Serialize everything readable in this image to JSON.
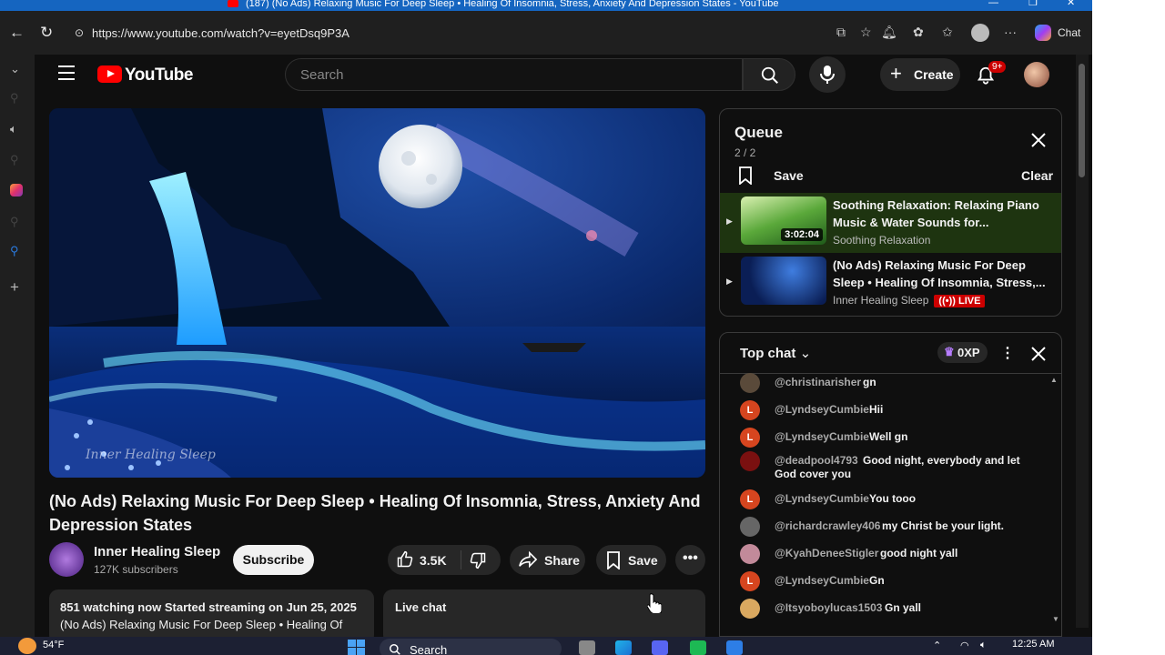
{
  "window": {
    "title": "(187) (No Ads) Relaxing Music For Deep Sleep • Healing Of Insomnia, Stress, Anxiety And Depression States - YouTube"
  },
  "browser": {
    "url": "https://www.youtube.com/watch?v=eyetDsq9P3A",
    "copilot_label": "Chat"
  },
  "header": {
    "logo_text": "YouTube",
    "search_placeholder": "Search",
    "create_label": "Create",
    "notifications_badge": "9+"
  },
  "video": {
    "title": "(No Ads) Relaxing Music For Deep Sleep • Healing Of Insomnia, Stress, Anxiety And Depression States",
    "watermark": "Inner Healing Sleep",
    "channel_name": "Inner Healing Sleep",
    "subscribers": "127K subscribers",
    "subscribe_label": "Subscribe",
    "like_count": "3.5K",
    "share_label": "Share",
    "save_label": "Save",
    "description_line1": "851 watching now  Started streaming on Jun 25, 2025",
    "description_line2": "(No Ads) Relaxing Music For Deep Sleep • Healing Of",
    "live_chat_label": "Live chat"
  },
  "queue": {
    "title": "Queue",
    "count": "2 / 2",
    "save_label": "Save",
    "clear_label": "Clear",
    "items": [
      {
        "title": "Soothing Relaxation: Relaxing Piano Music & Water Sounds for...",
        "channel": "Soothing Relaxation",
        "duration": "3:02:04"
      },
      {
        "title": "(No Ads) Relaxing Music For Deep Sleep • Healing Of Insomnia, Stress,...",
        "channel": "Inner Healing Sleep",
        "live_label": "LIVE"
      }
    ]
  },
  "chat": {
    "mode": "Top chat",
    "xp_label": "0XP",
    "messages": [
      {
        "author": "@christinarisher",
        "text": "gn",
        "initial": "",
        "color": "#5a4a3a"
      },
      {
        "author": "@LyndseyCumbie",
        "text": "Hii",
        "initial": "L",
        "color": "#d6451f"
      },
      {
        "author": "@LyndseyCumbie",
        "text": "Well gn",
        "initial": "L",
        "color": "#d6451f"
      },
      {
        "author": "@deadpool4793",
        "text": "Good night, everybody and let",
        "text2": "God cover you",
        "initial": "",
        "color": "#7a1010"
      },
      {
        "author": "@LyndseyCumbie",
        "text": "You tooo",
        "initial": "L",
        "color": "#d6451f"
      },
      {
        "author": "@richardcrawley406",
        "text": "my Christ be your light.",
        "initial": "",
        "color": "#666666"
      },
      {
        "author": "@KyahDeneeStigler",
        "text": "good night yall",
        "initial": "",
        "color": "#c28a9a"
      },
      {
        "author": "@LyndseyCumbie",
        "text": "Gn",
        "initial": "L",
        "color": "#d6451f"
      },
      {
        "author": "@Itsyoboylucas1503",
        "text": "Gn yall",
        "initial": "",
        "color": "#d9a860"
      }
    ]
  },
  "taskbar": {
    "temperature": "54°F",
    "search_placeholder": "Search",
    "time": "12:25 AM"
  },
  "colors": {
    "accent_red": "#ff0000",
    "live_red": "#cc0000",
    "queue_active_bg": "#1e3410"
  }
}
